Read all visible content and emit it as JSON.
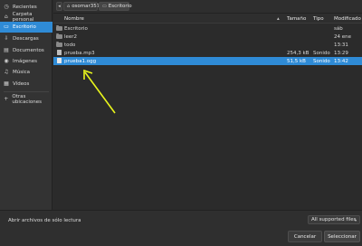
{
  "sidebar": {
    "items": [
      {
        "label": "Recientes",
        "icon": "clock-icon",
        "glyph": "◷"
      },
      {
        "label": "Carpeta personal",
        "icon": "home-icon",
        "glyph": "⌂"
      },
      {
        "label": "Escritorio",
        "icon": "desktop-icon",
        "glyph": "▭",
        "active": true
      },
      {
        "label": "Descargas",
        "icon": "download-icon",
        "glyph": "⇩"
      },
      {
        "label": "Documentos",
        "icon": "document-icon",
        "glyph": "▤"
      },
      {
        "label": "Imágenes",
        "icon": "camera-icon",
        "glyph": "◉"
      },
      {
        "label": "Música",
        "icon": "music-icon",
        "glyph": "♫"
      },
      {
        "label": "Vídeos",
        "icon": "video-icon",
        "glyph": "▦"
      },
      {
        "label": "Otras ubicaciones",
        "icon": "plus-icon",
        "glyph": "+"
      }
    ]
  },
  "pathbar": {
    "back_glyph": "◂",
    "crumbs": [
      {
        "label": "osomar357",
        "icon": "home-icon",
        "glyph": "⌂"
      },
      {
        "label": "Escritorio",
        "icon": "folder-icon",
        "glyph": "▭"
      }
    ]
  },
  "filelist": {
    "columns": {
      "name": "Nombre",
      "size": "Tamaño",
      "type": "Tipo",
      "modified": "Modificado"
    },
    "sort_glyph": "▴",
    "rows": [
      {
        "kind": "folder",
        "name": "Escritorio",
        "size": "",
        "type": "",
        "modified": "sáb"
      },
      {
        "kind": "folder",
        "name": "leer2",
        "size": "",
        "type": "",
        "modified": "24 ene"
      },
      {
        "kind": "folder",
        "name": "todo",
        "size": "",
        "type": "",
        "modified": "13:31"
      },
      {
        "kind": "file",
        "name": "prueba.mp3",
        "size": "254,3 kB",
        "type": "Sonido",
        "modified": "13:29"
      },
      {
        "kind": "file",
        "name": "prueba1.ogg",
        "size": "51,5 kB",
        "type": "Sonido",
        "modified": "13:42",
        "selected": true
      }
    ]
  },
  "bottombar": {
    "readonly_label": "Abrir archivos de sólo lectura",
    "filter_value": "All supported files",
    "filter_caret": "▾",
    "cancel_label": "Cancelar",
    "select_label": "Seleccionar"
  },
  "colors": {
    "accent": "#2f8bd6",
    "arrow": "#e8f51c",
    "background": "#2b2b2b"
  }
}
